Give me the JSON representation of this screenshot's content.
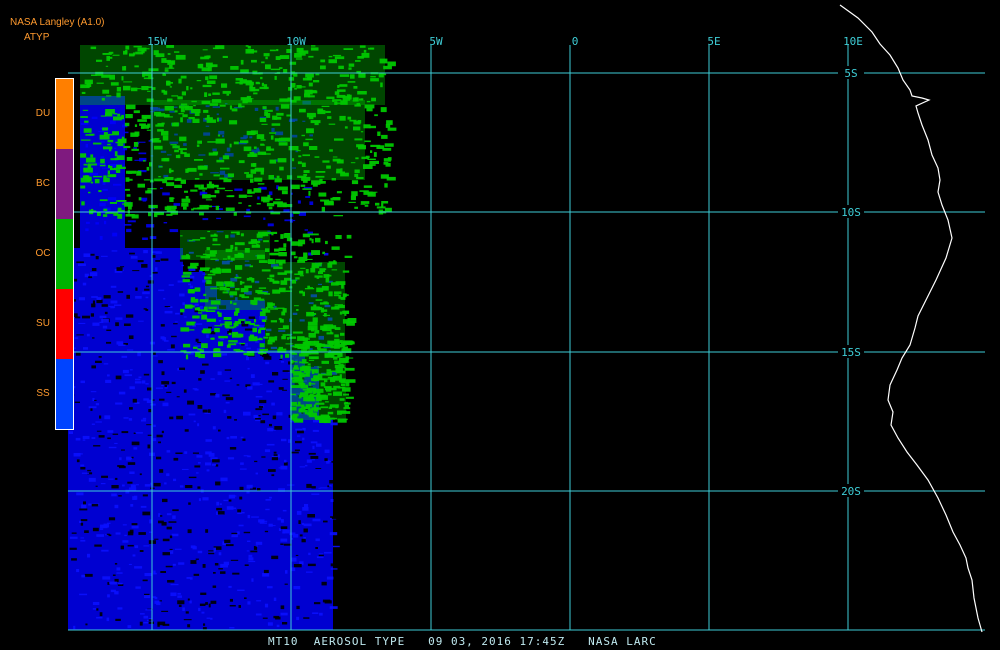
{
  "header": {
    "source": "NASA Langley (A1.0)",
    "product": "ATYP"
  },
  "legend": {
    "items": [
      {
        "label": "DU",
        "color": "#ff7f00"
      },
      {
        "label": "BC",
        "color": "#7f1a7f"
      },
      {
        "label": "OC",
        "color": "#00b300"
      },
      {
        "label": "SU",
        "color": "#ff0000"
      },
      {
        "label": "SS",
        "color": "#0044ff"
      }
    ],
    "border_color": "#ffffff"
  },
  "map": {
    "grid_color": "#3ecdd6",
    "label_color": "#3ecdd6",
    "coast_color": "#ffffff",
    "background": "#000000",
    "longitude_labels": [
      "15W",
      "10W",
      "5W",
      "0",
      "5E",
      "10E"
    ],
    "latitude_labels": [
      "5S",
      "10S",
      "15S",
      "20S"
    ],
    "aerosol_colors": {
      "organic_carbon": "#00c800",
      "sea_salt": "#0000ff"
    }
  },
  "footer": {
    "text": "MT10  AEROSOL TYPE   09 03, 2016 17:45Z   NASA LARC"
  }
}
